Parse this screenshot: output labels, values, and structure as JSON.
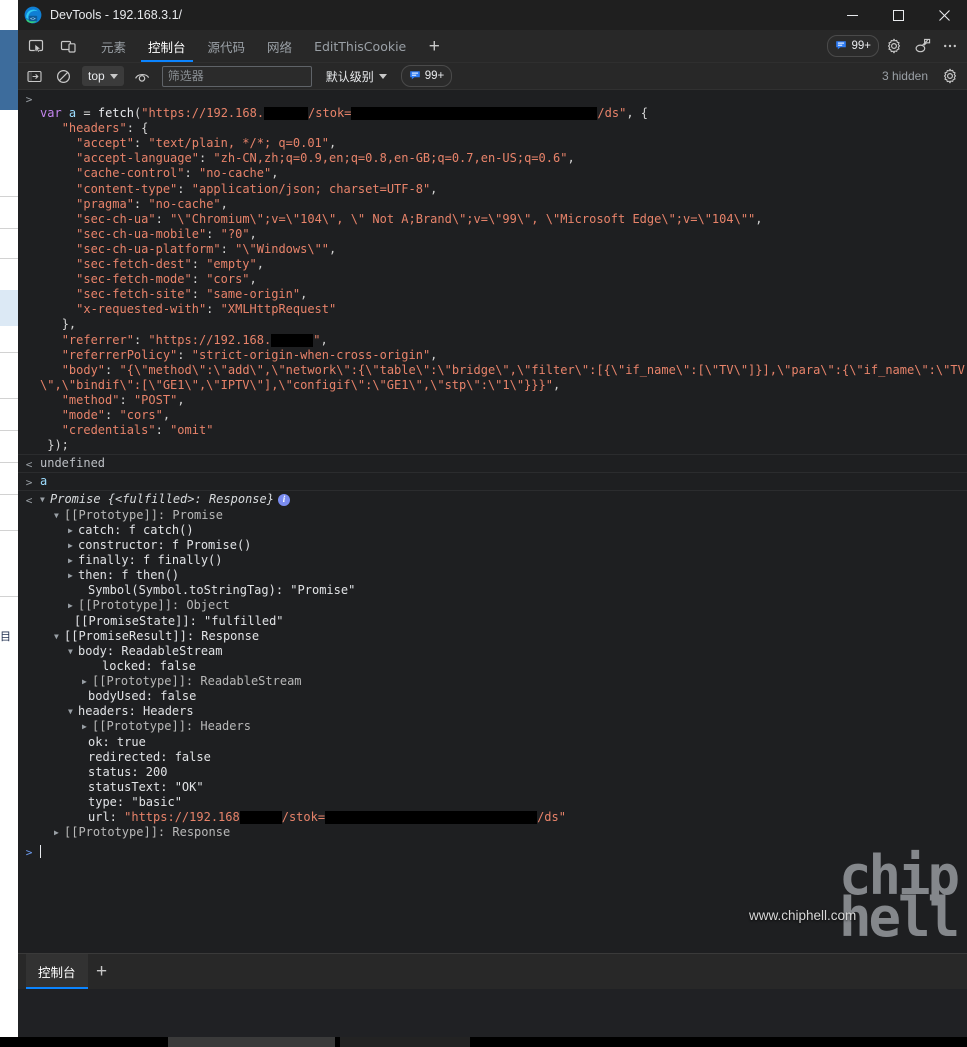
{
  "window": {
    "title": "DevTools - 192.168.3.1/",
    "logo_icon": "edge-devtools-logo",
    "minimize_label": "─",
    "maximize_label": "☐",
    "close_label": "✕"
  },
  "tabstrip": {
    "inspect_icon": "inspect-element-icon",
    "device_icon": "device-toolbar-icon",
    "tabs": [
      {
        "label": "元素",
        "selected": false
      },
      {
        "label": "控制台",
        "selected": true
      },
      {
        "label": "源代码",
        "selected": false
      },
      {
        "label": "网络",
        "selected": false
      },
      {
        "label": "EditThisCookie",
        "selected": false
      }
    ],
    "add_tab_label": "+",
    "issues_count": "99+",
    "issues_icon": "issues-bubble-icon",
    "settings_icon": "gear-icon",
    "customize_icon": "devtools-customize-icon",
    "more_icon": "more-options-icon"
  },
  "console_toolbar": {
    "sidebar_icon": "console-sidebar-icon",
    "clear_icon": "clear-console-icon",
    "context": "top",
    "eye_icon": "live-expression-icon",
    "filter_value": "",
    "filter_placeholder": "筛选器",
    "level": "默认级别",
    "issues_count": "99+",
    "hidden_text": "3 hidden",
    "settings_icon": "console-settings-icon"
  },
  "console": {
    "input_prompt_icon": ">",
    "output_prompt_icon": "<",
    "entries": [
      {
        "type": "input",
        "lines": [
          "var a = fetch(\"https://192.168.███/stok=████████████████████/ds\", {",
          "  \"headers\": {",
          "    \"accept\": \"text/plain, */*; q=0.01\",",
          "    \"accept-language\": \"zh-CN,zh;q=0.9,en;q=0.8,en-GB;q=0.7,en-US;q=0.6\",",
          "    \"cache-control\": \"no-cache\",",
          "    \"content-type\": \"application/json; charset=UTF-8\",",
          "    \"pragma\": \"no-cache\",",
          "    \"sec-ch-ua\": \"\\\"Chromium\\\";v=\\\"104\\\", \\\" Not A;Brand\\\";v=\\\"99\\\", \\\"Microsoft Edge\\\";v=\\\"104\\\"\",",
          "    \"sec-ch-ua-mobile\": \"?0\",",
          "    \"sec-ch-ua-platform\": \"\\\"Windows\\\"\",",
          "    \"sec-fetch-dest\": \"empty\",",
          "    \"sec-fetch-mode\": \"cors\",",
          "    \"sec-fetch-site\": \"same-origin\",",
          "    \"x-requested-with\": \"XMLHttpRequest\"",
          "  },",
          "  \"referrer\": \"https://192.168.████\",",
          "  \"referrerPolicy\": \"strict-origin-when-cross-origin\",",
          "  \"body\": \"{\\\"method\\\":\\\"add\\\",\\\"network\\\":{\\\"table\\\":\\\"bridge\\\",\\\"filter\\\":[{\\\"if_name\\\":[\\\"TV\\\"]}],\\\"para\\\":{\\\"if_name\\\":\\\"TV\\\",\\\"bindif\\\":[\\\"GE1\\\",\\\"IPTV\\\"],\\\"configif\\\":\\\"GE1\\\",\\\"stp\\\":\\\"1\\\"}}}\",",
          "  \"method\": \"POST\",",
          "  \"mode\": \"cors\",",
          "  \"credentials\": \"omit\"",
          "});"
        ]
      },
      {
        "type": "output",
        "text": "undefined"
      },
      {
        "type": "input",
        "text": "a"
      },
      {
        "type": "object",
        "header": "Promise {<fulfilled>: Response}",
        "info_badge": "i",
        "nodes": [
          {
            "indent": 1,
            "tri": "open",
            "text": "[[Prototype]]: Promise"
          },
          {
            "indent": 2,
            "tri": "closed",
            "text": "catch: f catch()"
          },
          {
            "indent": 2,
            "tri": "closed",
            "text": "constructor: f Promise()"
          },
          {
            "indent": 2,
            "tri": "closed",
            "text": "finally: f finally()"
          },
          {
            "indent": 2,
            "tri": "closed",
            "text": "then: f then()"
          },
          {
            "indent": 2,
            "tri": "none",
            "text": "Symbol(Symbol.toStringTag): \"Promise\""
          },
          {
            "indent": 2,
            "tri": "closed",
            "text": "[[Prototype]]: Object"
          },
          {
            "indent": 1,
            "tri": "none",
            "text": "[[PromiseState]]: \"fulfilled\""
          },
          {
            "indent": 1,
            "tri": "open",
            "text": "[[PromiseResult]]: Response"
          },
          {
            "indent": 2,
            "tri": "open",
            "text": "body: ReadableStream"
          },
          {
            "indent": 3,
            "tri": "none",
            "text": "locked: false"
          },
          {
            "indent": 3,
            "tri": "closed",
            "text": "[[Prototype]]: ReadableStream"
          },
          {
            "indent": 2,
            "tri": "none",
            "text": "bodyUsed: false"
          },
          {
            "indent": 2,
            "tri": "open",
            "text": "headers: Headers"
          },
          {
            "indent": 3,
            "tri": "closed",
            "text": "[[Prototype]]: Headers"
          },
          {
            "indent": 2,
            "tri": "none",
            "text": "ok: true"
          },
          {
            "indent": 2,
            "tri": "none",
            "text": "redirected: false"
          },
          {
            "indent": 2,
            "tri": "none",
            "text": "status: 200"
          },
          {
            "indent": 2,
            "tri": "none",
            "text": "statusText: \"OK\""
          },
          {
            "indent": 2,
            "tri": "none",
            "text": "type: \"basic\""
          },
          {
            "indent": 2,
            "tri": "none",
            "text": "url: \"https://192.168████/stok=████████████████████████/ds\""
          },
          {
            "indent": 1,
            "tri": "closed",
            "text": "[[Prototype]]: Response"
          }
        ]
      }
    ]
  },
  "watermark": {
    "url": "www.chiphell.com",
    "logo_line1": "chip",
    "logo_line2": "hell"
  },
  "drawer": {
    "tab_label": "控制台",
    "add_label": "+"
  },
  "colors": {
    "accent": "#0b84ff",
    "panel_bg": "#1e1f21",
    "toolbar_bg": "#282828",
    "titlebar_bg": "#1f1f1f",
    "string": "#e8836a",
    "keyword": "#c586f0",
    "number": "#9980ff",
    "variable": "#9cdcfe"
  }
}
